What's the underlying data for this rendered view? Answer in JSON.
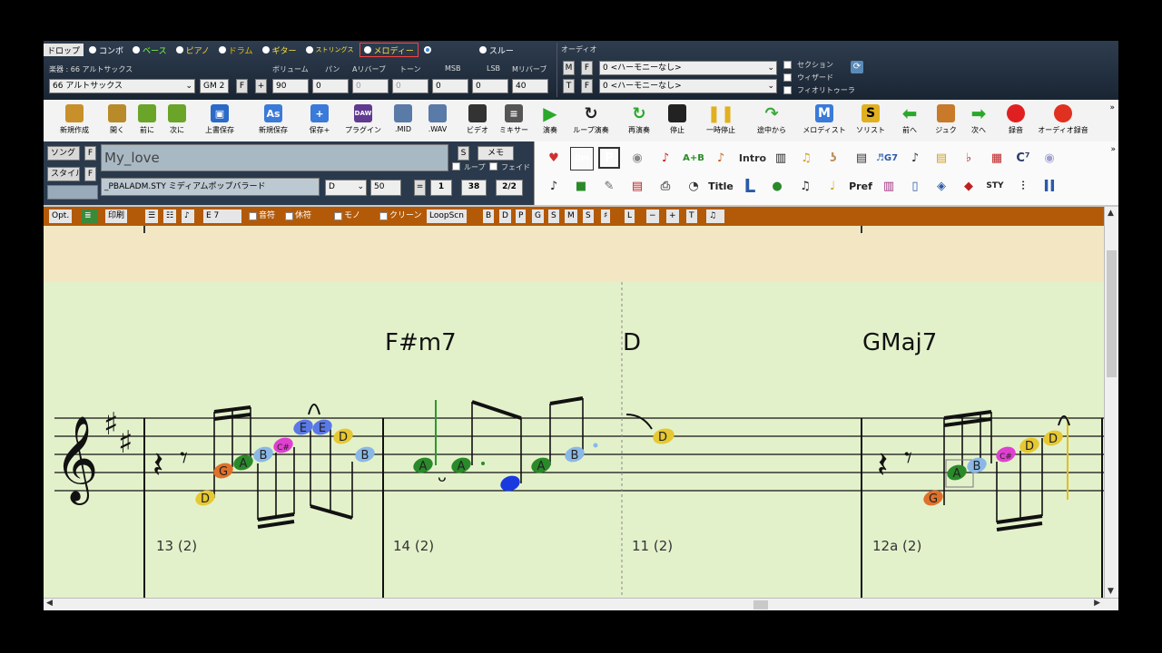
{
  "mode_tabs": [
    {
      "label": "ドロップ",
      "color": "#000000"
    },
    {
      "label": "コンボ",
      "color": "#ffffff"
    },
    {
      "label": "ベース",
      "color": "#7cff3c"
    },
    {
      "label": "ピアノ",
      "color": "#ffd23c"
    },
    {
      "label": "ドラム",
      "color": "#f0c000"
    },
    {
      "label": "ギター",
      "color": "#ffe03c"
    },
    {
      "label": "ストリングス",
      "color": "#ffe03c"
    },
    {
      "label": "メロディー",
      "color": "#ffe03c"
    },
    {
      "label": "",
      "color": "#ff3030"
    },
    {
      "label": "スルー",
      "color": "#ffffff"
    }
  ],
  "audio_label": "オーディオ",
  "instrument": {
    "header": "楽器 : 66 アルトサックス",
    "value": "66 アルトサックス",
    "bank": "GM 2",
    "f": "F",
    "plus": "+"
  },
  "mixer_labels": {
    "volume": "ボリューム",
    "pan": "パン",
    "areverb": "Aリバーブ",
    "tone": "トーン",
    "msb": "MSB",
    "lsb": "LSB",
    "mreverb": "Mリバーブ"
  },
  "mixer_values": {
    "volume": "90",
    "pan": "0",
    "areverb": "0",
    "tone": "0",
    "msb": "0",
    "lsb": "0",
    "mreverb": "40"
  },
  "harmony": [
    {
      "m": "M",
      "f": "F",
      "value": "0 <ハーモニーなし>"
    },
    {
      "m": "T",
      "f": "F",
      "value": "0 <ハーモニーなし>"
    }
  ],
  "right_checks": [
    "セクション",
    "ウィザード",
    "フィオリトゥーラ"
  ],
  "toolbar": [
    {
      "label": "新規作成",
      "color": "#c8902a"
    },
    {
      "label": "開く",
      "color": "#b88a2a"
    },
    {
      "label": "前に",
      "color": "#6aa52a"
    },
    {
      "label": "次に",
      "color": "#6aa52a"
    },
    {
      "label": "上書保存",
      "color": "#2a6ac8"
    },
    {
      "label": "新規保存",
      "color": "#3a7ad8"
    },
    {
      "label": "保存+",
      "color": "#3a7ad8"
    },
    {
      "label": "プラグイン",
      "color": "#603a90"
    },
    {
      "label": ".MID",
      "color": "#5a7aa8"
    },
    {
      "label": ".WAV",
      "color": "#5a7aa8"
    },
    {
      "label": "ビデオ",
      "color": "#333333"
    },
    {
      "label": "ミキサー",
      "color": "#555555"
    },
    {
      "label": "演奏",
      "color": "#2aa82a"
    },
    {
      "label": "ループ演奏",
      "color": "#2a2a2a"
    },
    {
      "label": "再演奏",
      "color": "#2aa82a"
    },
    {
      "label": "停止",
      "color": "#222222"
    },
    {
      "label": "一時停止",
      "color": "#e0b020"
    },
    {
      "label": "途中から",
      "color": "#3aa83a"
    },
    {
      "label": "メロディスト",
      "color": "#2a5aa8"
    },
    {
      "label": "ソリスト",
      "color": "#e0b020"
    },
    {
      "label": "前へ",
      "color": "#2aa82a"
    },
    {
      "label": "ジュク",
      "color": "#c87a2a"
    },
    {
      "label": "次へ",
      "color": "#2aa82a"
    },
    {
      "label": "録音",
      "color": "#e02020"
    },
    {
      "label": "オーディオ録音",
      "color": "#e03020"
    }
  ],
  "toolbar_icon_text": {
    "mixer": "",
    "daw": "DAW",
    "melodist": "M",
    "soloist": "S"
  },
  "song": {
    "song_label": "ソング",
    "style_label": "スタイル",
    "f": "F",
    "title": "My_love",
    "style": "_PBALADM.STY ミディアムポップバラード",
    "s": "S",
    "memo": "メモ",
    "loop": "ループ",
    "fade": "フェイド",
    "key": "D",
    "tempo": "50",
    "start": "1",
    "end": "38",
    "choruses": "2/2"
  },
  "icon_panel_text": {
    "dm": "Dm",
    "p": "P",
    "ab": "A+B",
    "intro": "Intro",
    "g7": "♬G7",
    "c7": "C⁷",
    "title": "Title",
    "l": "L",
    "pref": "Pref",
    "sty": "STY",
    "pi": "II"
  },
  "notebar": {
    "opt": "Opt.",
    "print": "印刷",
    "track": "E 7",
    "notes": "音符",
    "rests": "休符",
    "mono": "モノ",
    "clean": "クリーン",
    "loop": "LoopScn",
    "letters": [
      "B",
      "D",
      "P",
      "G",
      "S",
      "M",
      "S",
      "♯"
    ],
    "ctrl": [
      "L",
      "−",
      "+",
      "T"
    ]
  },
  "score": {
    "chords": [
      "F#m7",
      "D",
      "GMaj7"
    ],
    "bar_numbers": [
      "13 (2)",
      "14 (2)",
      "11 (2)",
      "12a (2)"
    ],
    "note_labels": [
      "D",
      "G",
      "A",
      "B",
      "C#",
      "E",
      "E",
      "D",
      "B",
      "A",
      "A",
      "A",
      "B",
      "D",
      "D",
      "G",
      "A",
      "B",
      "C#",
      "D",
      "D"
    ]
  },
  "note_colors": {
    "D": "#e6c832",
    "E": "#5a78e6",
    "F#": "#e07a2a",
    "G": "#e0702a",
    "A": "#2a8a2a",
    "B": "#8ab8e6",
    "C#": "#e040d0"
  }
}
